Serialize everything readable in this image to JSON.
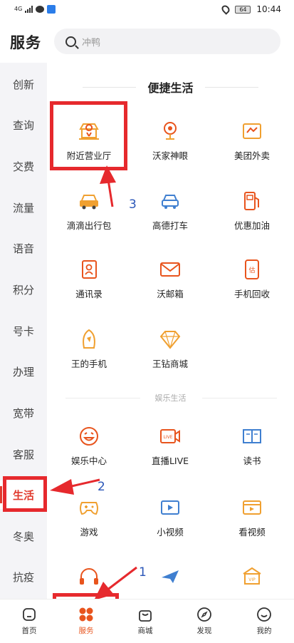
{
  "status_bar": {
    "network": "4G",
    "time": "10:44",
    "battery": "64"
  },
  "header": {
    "title": "服务",
    "search_placeholder": "冲鸭"
  },
  "sidebar": {
    "items": [
      {
        "label": "创新"
      },
      {
        "label": "查询"
      },
      {
        "label": "交费"
      },
      {
        "label": "流量"
      },
      {
        "label": "语音"
      },
      {
        "label": "积分"
      },
      {
        "label": "号卡"
      },
      {
        "label": "办理"
      },
      {
        "label": "宽带"
      },
      {
        "label": "客服"
      },
      {
        "label": "生活"
      },
      {
        "label": "冬奥"
      },
      {
        "label": "抗疫"
      }
    ],
    "active": "生活"
  },
  "main": {
    "section_title": "便捷生活",
    "life_items": [
      {
        "label": "附近营业厅",
        "icon": "store-location-icon"
      },
      {
        "label": "沃家神眼",
        "icon": "camera-eye-icon"
      },
      {
        "label": "美团外卖",
        "icon": "takeout-icon"
      },
      {
        "label": "滴滴出行包",
        "icon": "car-icon"
      },
      {
        "label": "高德打车",
        "icon": "taxi-icon"
      },
      {
        "label": "优惠加油",
        "icon": "gas-station-icon"
      },
      {
        "label": "通讯录",
        "icon": "contacts-icon"
      },
      {
        "label": "沃邮箱",
        "icon": "mail-icon"
      },
      {
        "label": "手机回收",
        "icon": "phone-recycle-icon"
      },
      {
        "label": "王的手机",
        "icon": "king-phone-icon"
      },
      {
        "label": "王钻商城",
        "icon": "diamond-icon"
      }
    ],
    "entertainment_title": "娱乐生活",
    "entertainment_items": [
      {
        "label": "娱乐中心",
        "icon": "smile-icon"
      },
      {
        "label": "直播LIVE",
        "icon": "live-icon"
      },
      {
        "label": "读书",
        "icon": "book-icon"
      },
      {
        "label": "游戏",
        "icon": "gamepad-icon"
      },
      {
        "label": "小视频",
        "icon": "small-video-icon"
      },
      {
        "label": "看视频",
        "icon": "video-icon"
      },
      {
        "label": "",
        "icon": "headphones-icon"
      },
      {
        "label": "",
        "icon": "airplane-icon"
      },
      {
        "label": "",
        "icon": "vip-icon"
      }
    ]
  },
  "annotations": {
    "step1": "1",
    "step2": "2",
    "step3": "3"
  },
  "bottom_nav": {
    "items": [
      {
        "label": "首页",
        "icon": "home-icon"
      },
      {
        "label": "服务",
        "icon": "service-icon"
      },
      {
        "label": "商城",
        "icon": "shop-bag-icon"
      },
      {
        "label": "发现",
        "icon": "compass-icon"
      },
      {
        "label": "我的",
        "icon": "profile-icon"
      }
    ],
    "active": "服务"
  },
  "colors": {
    "accent": "#e03a2d",
    "icon_orange": "#f0a030",
    "icon_blue": "#3f7fd0",
    "annotation_red": "#e6292d",
    "annotation_blue": "#2a56b8"
  }
}
